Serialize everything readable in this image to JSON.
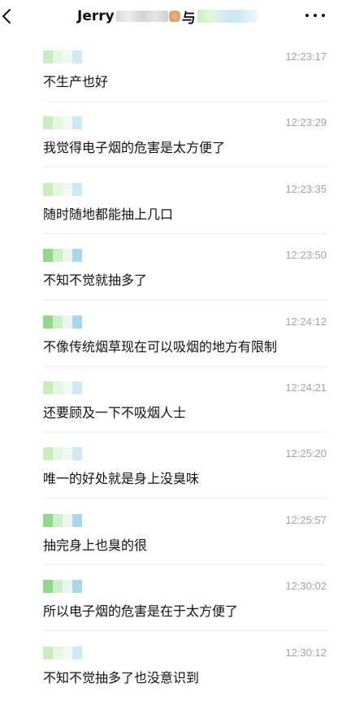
{
  "header": {
    "title_prefix": "Jerry",
    "title_middle": "与",
    "back_icon": "chevron-left-icon",
    "more_icon": "more-horizontal-icon"
  },
  "messages": [
    {
      "time": "12:23:17",
      "text": "不生产也好"
    },
    {
      "time": "12:23:29",
      "text": "我觉得电子烟的危害是太方便了"
    },
    {
      "time": "12:23:35",
      "text": "随时随地都能抽上几口"
    },
    {
      "time": "12:23:50",
      "text": "不知不觉就抽多了"
    },
    {
      "time": "12:24:12",
      "text": "不像传统烟草现在可以吸烟的地方有限制"
    },
    {
      "time": "12:24:21",
      "text": "还要顾及一下不吸烟人士"
    },
    {
      "time": "12:25:20",
      "text": "唯一的好处就是身上没臭味"
    },
    {
      "time": "12:25:57",
      "text": "抽完身上也臭的很"
    },
    {
      "time": "12:30:02",
      "text": "所以电子烟的危害是在于太方便了"
    },
    {
      "time": "12:30:12",
      "text": "不知不觉抽多了也没意识到"
    }
  ]
}
